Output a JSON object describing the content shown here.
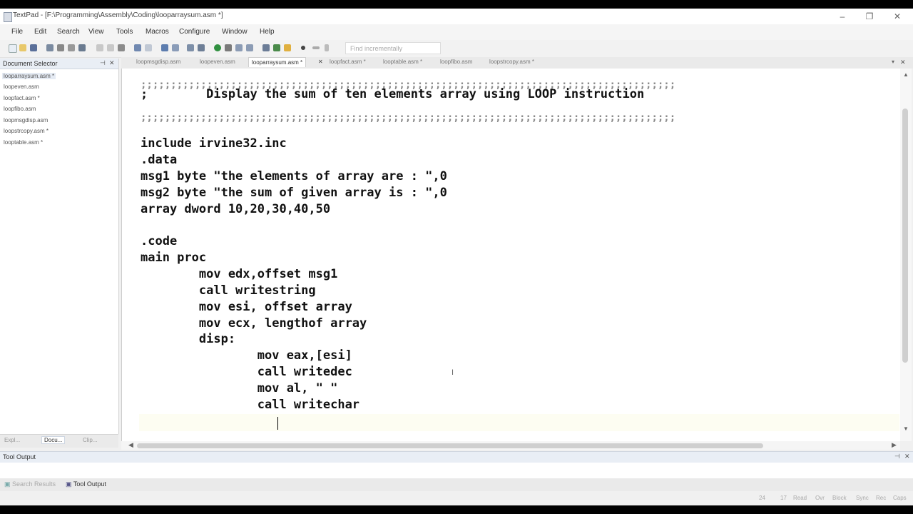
{
  "window": {
    "title": "TextPad - [F:\\Programming\\Assembly\\Coding\\looparraysum.asm *]",
    "controls": {
      "minimize": "–",
      "maximize": "❐",
      "close": "✕"
    }
  },
  "menu": [
    "File",
    "Edit",
    "Search",
    "View",
    "Tools",
    "Macros",
    "Configure",
    "Window",
    "Help"
  ],
  "toolbar": {
    "find_placeholder": "Find incrementally"
  },
  "document_selector": {
    "title": "Document Selector",
    "pin": "⊣",
    "close": "✕",
    "items": [
      "looparraysum.asm *",
      "loopeven.asm",
      "loopfact.asm *",
      "loopfibo.asm",
      "loopmsgdisp.asm",
      "loopstrcopy.asm *",
      "looptable.asm *"
    ],
    "tabs": [
      "Expl...",
      "Docu...",
      "Clip..."
    ]
  },
  "tabs": [
    "loopmsgdisp.asm",
    "loopeven.asm",
    "looparraysum.asm *",
    "loopfact.asm *",
    "looptable.asm *",
    "loopfibo.asm",
    "loopstrcopy.asm *"
  ],
  "editor": {
    "lines": [
      ";;;;;;;;;;;;;;;;;;;;;;;;;;;;;;;;;;;;;;;;;;;;;;;;;;;;;;;;;;;;;;;;;;;;;;;;;;;;;;;;;;;;;;;;;",
      ";        Display the sum of ten elements array using LOOP instruction",
      ";;;;;;;;;;;;;;;;;;;;;;;;;;;;;;;;;;;;;;;;;;;;;;;;;;;;;;;;;;;;;;;;;;;;;;;;;;;;;;;;;;;;;;;;;",
      "",
      "include irvine32.inc",
      ".data",
      "msg1 byte \"the elements of array are : \",0",
      "msg2 byte \"the sum of given array is : \",0",
      "array dword 10,20,30,40,50",
      "",
      ".code",
      "main proc",
      "        mov edx,offset msg1",
      "        call writestring",
      "        mov esi, offset array",
      "        mov ecx, lengthof array",
      "        disp:",
      "                mov eax,[esi]",
      "                call writedec",
      "                mov al, \" \"",
      "                call writechar",
      ""
    ]
  },
  "tool_output": {
    "title": "Tool Output",
    "pin": "⊣",
    "close": "✕",
    "tabs": [
      "Search Results",
      "Tool Output"
    ]
  },
  "status": {
    "line": "24",
    "col": "17",
    "read": "Read",
    "ovr": "Ovr",
    "block": "Block",
    "sync": "Sync",
    "rec": "Rec",
    "caps": "Caps"
  }
}
